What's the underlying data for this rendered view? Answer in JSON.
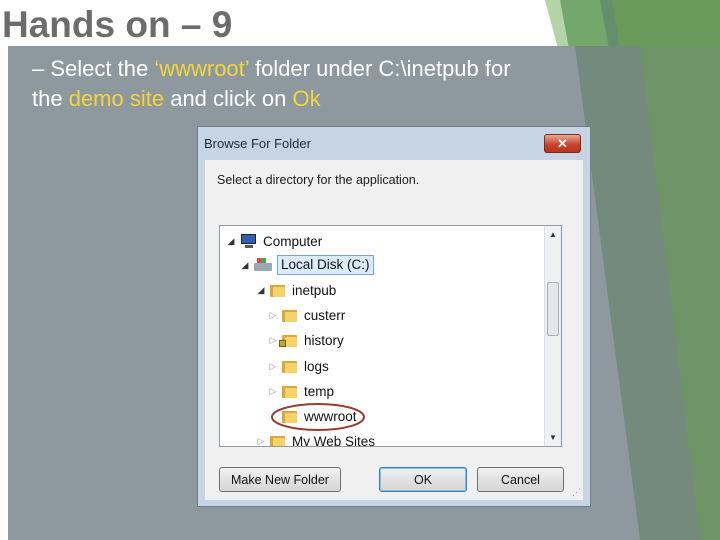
{
  "slide": {
    "title": "Hands on – 9",
    "bullet": {
      "prefix": "– Select the ",
      "folder_name": "‘wwwroot’",
      "middle": " folder under C:\\inetpub for",
      "line2_prefix": "the ",
      "site": "demo site",
      "line2_mid": " and click on ",
      "ok": "Ok"
    }
  },
  "dialog": {
    "title": "Browse For Folder",
    "close_glyph": "✕",
    "instruction": "Select a directory for the application.",
    "tree": [
      {
        "label": "Computer",
        "icon": "computer-icon",
        "state": "expanded",
        "level": 0
      },
      {
        "label": "Local Disk (C:)",
        "icon": "drive-icon",
        "state": "expanded",
        "level": 1,
        "selected": true
      },
      {
        "label": "inetpub",
        "icon": "folder-icon",
        "state": "expanded",
        "level": 2
      },
      {
        "label": "custerr",
        "icon": "folder-icon",
        "state": "collapsed",
        "level": 3
      },
      {
        "label": "history",
        "icon": "folder-locked-icon",
        "state": "collapsed",
        "level": 3
      },
      {
        "label": "logs",
        "icon": "folder-icon",
        "state": "collapsed",
        "level": 3
      },
      {
        "label": "temp",
        "icon": "folder-icon",
        "state": "collapsed",
        "level": 3
      },
      {
        "label": "wwwroot",
        "icon": "folder-icon",
        "state": "none",
        "level": 3,
        "circled": true
      },
      {
        "label": "My Web Sites",
        "icon": "folder-icon",
        "state": "collapsed",
        "level": 2
      }
    ],
    "buttons": {
      "new_folder": "Make New Folder",
      "ok": "OK",
      "cancel": "Cancel"
    }
  },
  "colors": {
    "highlight": "#f4d53a",
    "annotation_circle": "#9b3b2a"
  }
}
